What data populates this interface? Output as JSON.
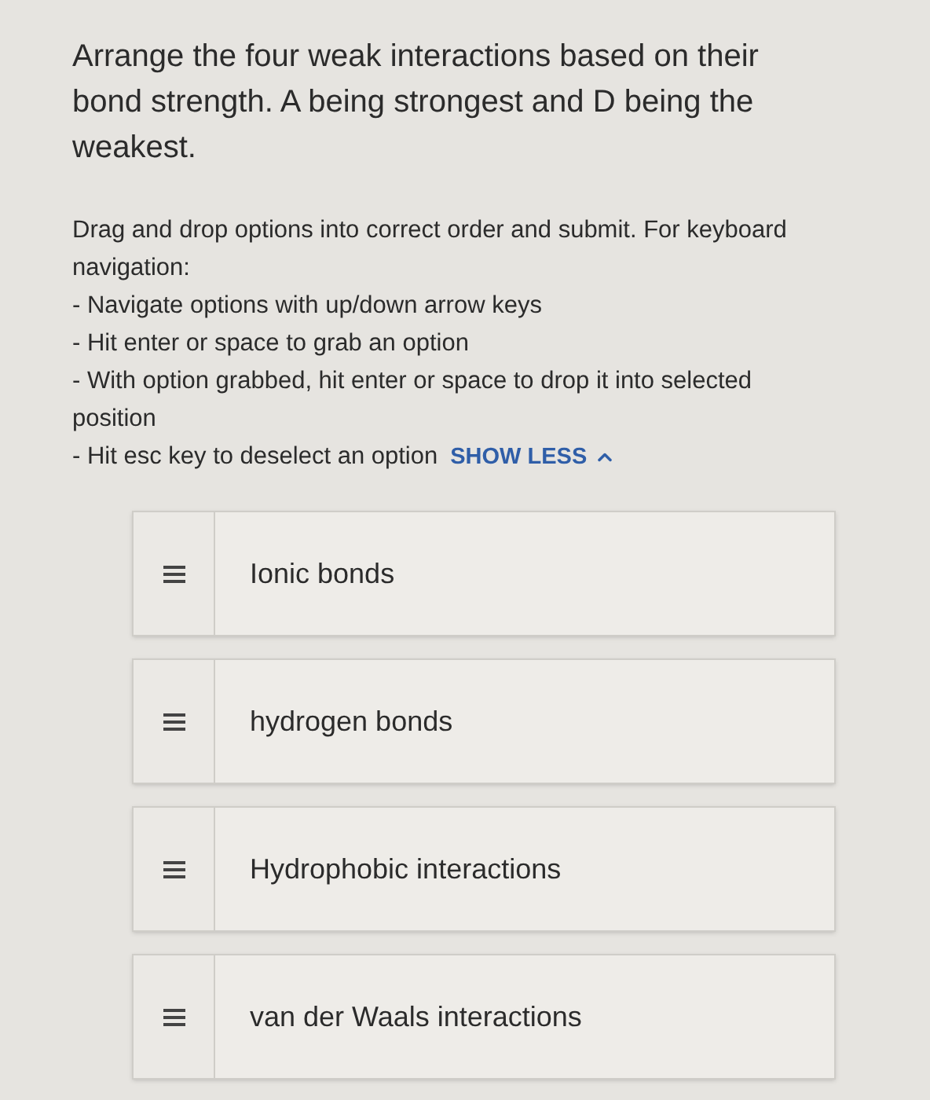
{
  "question": "Arrange the four weak interactions based on their bond strength. A being strongest and D being the weakest.",
  "instructions": {
    "intro": "Drag and drop options into correct order and submit. For keyboard navigation:",
    "steps": [
      "- Navigate options with up/down arrow keys",
      "- Hit enter or space to grab an option",
      "- With option grabbed, hit enter or space to drop it into selected position",
      "- Hit esc key to deselect an option"
    ],
    "toggle": "SHOW LESS"
  },
  "options": [
    {
      "label": "Ionic bonds"
    },
    {
      "label": "hydrogen bonds"
    },
    {
      "label": "Hydrophobic interactions"
    },
    {
      "label": "van der Waals interactions"
    }
  ]
}
